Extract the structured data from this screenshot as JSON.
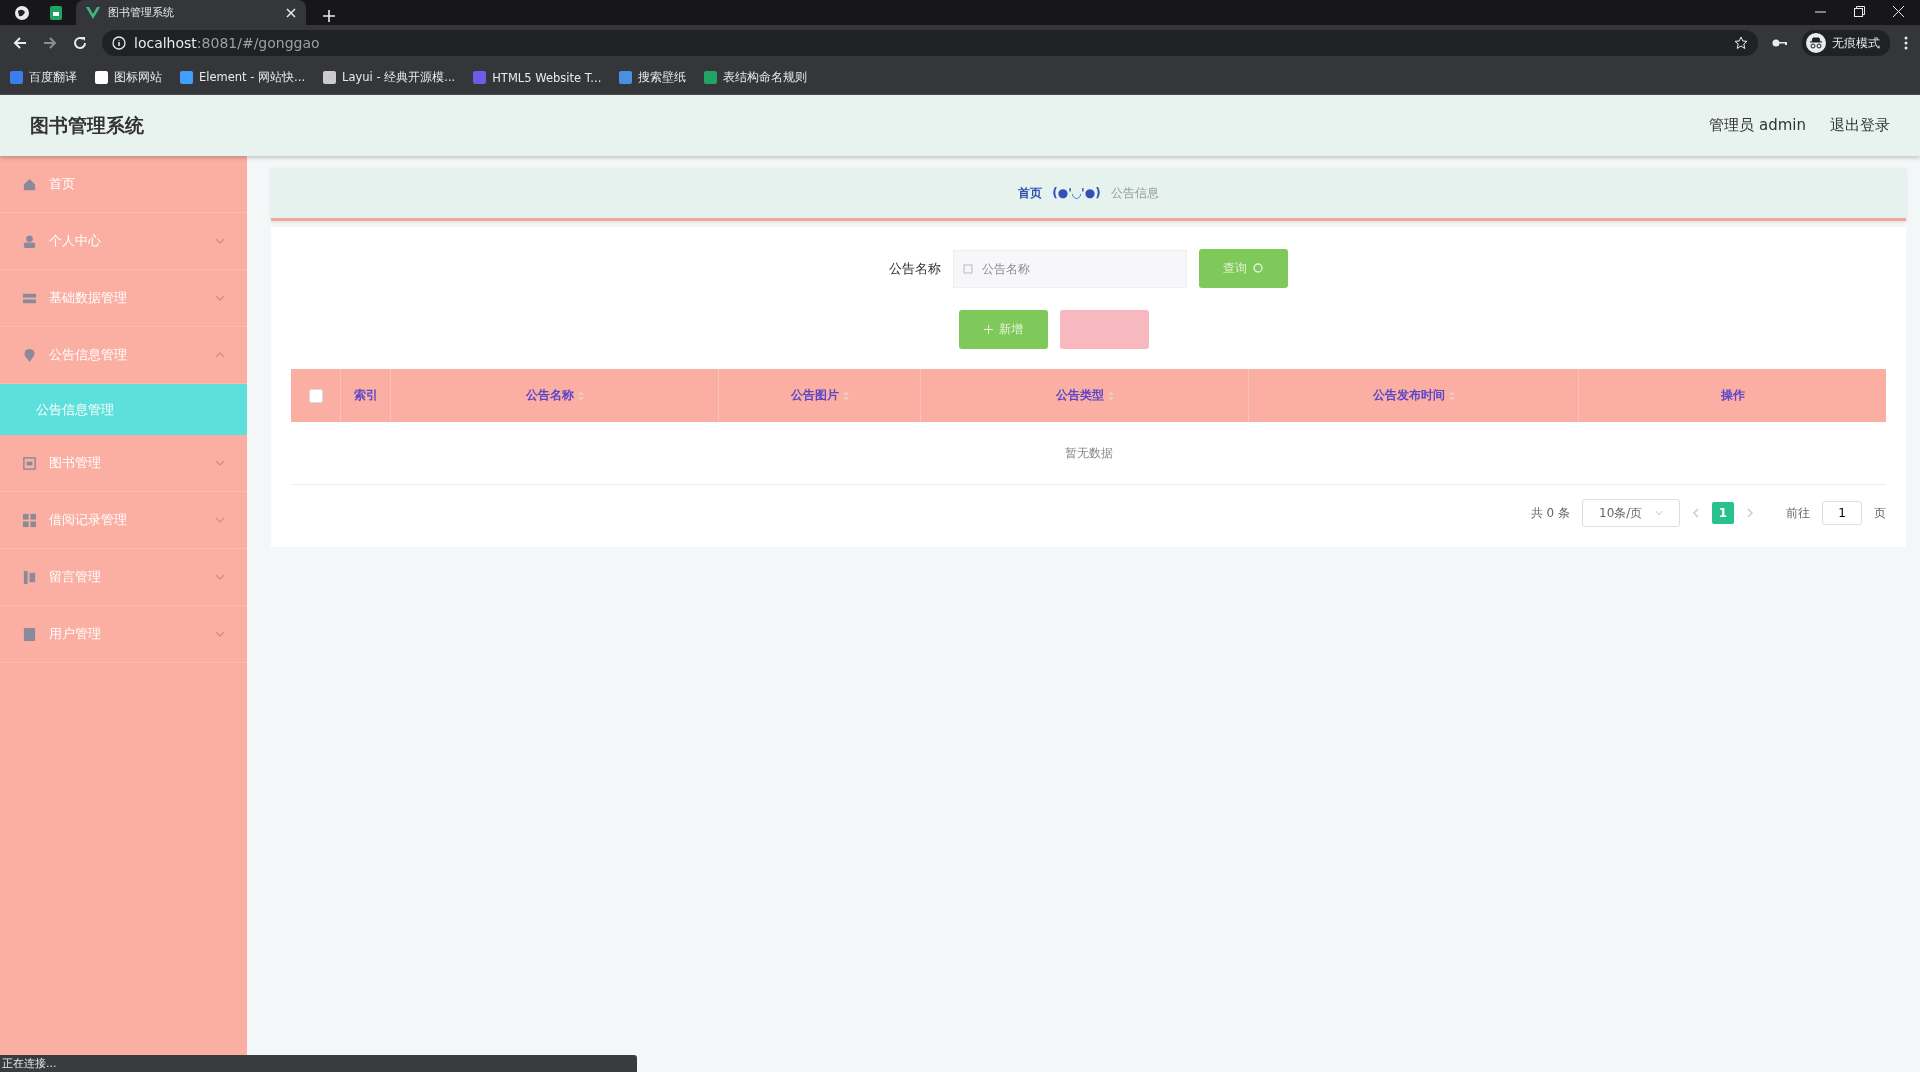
{
  "browser": {
    "tabs": [
      {
        "title": "图书管理系统",
        "selected": true
      }
    ],
    "address": {
      "host": "localhost",
      "path": ":8081/#/gonggao"
    },
    "bookmarks": [
      "百度翻译",
      "图标网站",
      "Element - 网站快...",
      "Layui - 经典开源模...",
      "HTML5 Website T...",
      "搜索壁纸",
      "表结构命名规则"
    ],
    "incognito": "无痕模式"
  },
  "header": {
    "title": "图书管理系统",
    "user": "管理员 admin",
    "logout": "退出登录"
  },
  "sidebar": {
    "items": [
      {
        "label": "首页",
        "kind": "link",
        "selected": false
      },
      {
        "label": "个人中心",
        "kind": "group",
        "expanded": false,
        "selected": false
      },
      {
        "label": "基础数据管理",
        "kind": "group",
        "expanded": false,
        "selected": false
      },
      {
        "label": "公告信息管理",
        "kind": "group",
        "expanded": true,
        "selected": false,
        "children": [
          {
            "label": "公告信息管理",
            "selected": true
          }
        ]
      },
      {
        "label": "图书管理",
        "kind": "group",
        "expanded": false,
        "selected": false
      },
      {
        "label": "借阅记录管理",
        "kind": "group",
        "expanded": false,
        "selected": false
      },
      {
        "label": "留言管理",
        "kind": "group",
        "expanded": false,
        "selected": false
      },
      {
        "label": "用户管理",
        "kind": "group",
        "expanded": false,
        "selected": false
      }
    ]
  },
  "breadcrumb": [
    "首页",
    "(●'◡'●)",
    "公告信息"
  ],
  "search": {
    "label": "公告名称",
    "placeholder": "公告名称",
    "button": "查询"
  },
  "actions": {
    "add": "新增"
  },
  "table": {
    "select_all_checked": false,
    "columns": [
      "索引",
      "公告名称",
      "公告图片",
      "公告类型",
      "公告发布时间",
      "操作"
    ],
    "empty": "暂无数据"
  },
  "pagination": {
    "total": "共 0 条",
    "page_size": "10条/页",
    "pages": [
      {
        "label": "1",
        "selected": true
      }
    ],
    "goto": "前往",
    "page_value": "1",
    "page_unit": "页"
  },
  "status_bar": "正在连接..."
}
